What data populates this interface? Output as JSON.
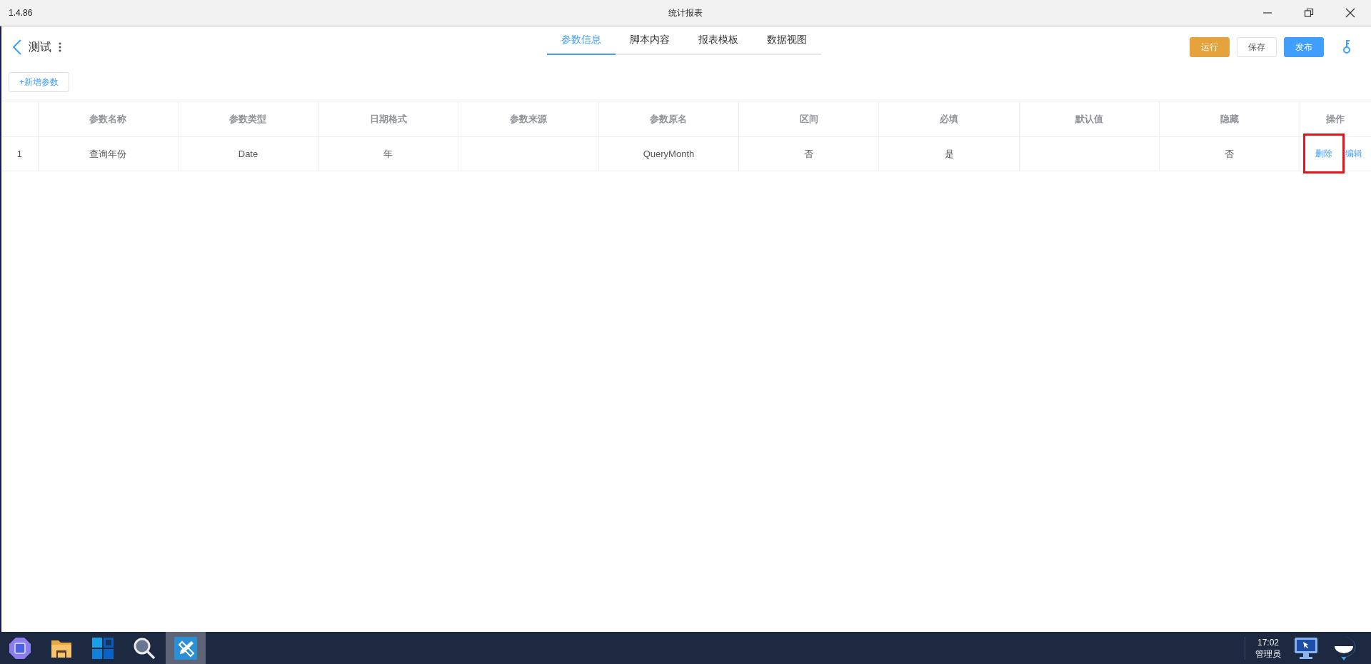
{
  "window": {
    "version": "1.4.86",
    "title": "统计报表"
  },
  "header": {
    "title": "测试",
    "tabs": [
      {
        "label": "参数信息",
        "selected": true
      },
      {
        "label": "脚本内容",
        "selected": false
      },
      {
        "label": "报表模板",
        "selected": false
      },
      {
        "label": "数据视图",
        "selected": false
      }
    ],
    "buttons": [
      {
        "label": "运行",
        "kind": "warning"
      },
      {
        "label": "保存",
        "kind": "default"
      },
      {
        "label": "发布",
        "kind": "primary"
      }
    ]
  },
  "add_button": "+新增参数",
  "table": {
    "columns": [
      "",
      "参数名称",
      "参数类型",
      "日期格式",
      "参数来源",
      "参数原名",
      "区间",
      "必填",
      "默认值",
      "隐藏",
      "操作"
    ],
    "rows": [
      {
        "cells": [
          "1",
          "查询年份",
          "Date",
          "年",
          "",
          "QueryMonth",
          "否",
          "是",
          "",
          "否"
        ],
        "actions": [
          {
            "label": "删除",
            "highlighted": true
          },
          {
            "label": "编辑",
            "highlighted": false
          }
        ]
      }
    ]
  },
  "taskbar": {
    "apps": [
      {
        "kind": "hub",
        "selected": false
      },
      {
        "kind": "folder",
        "selected": false
      },
      {
        "kind": "tiles",
        "selected": false
      },
      {
        "kind": "search",
        "selected": false
      },
      {
        "kind": "design",
        "selected": true
      }
    ],
    "time": "17:02",
    "user": "管理员"
  }
}
